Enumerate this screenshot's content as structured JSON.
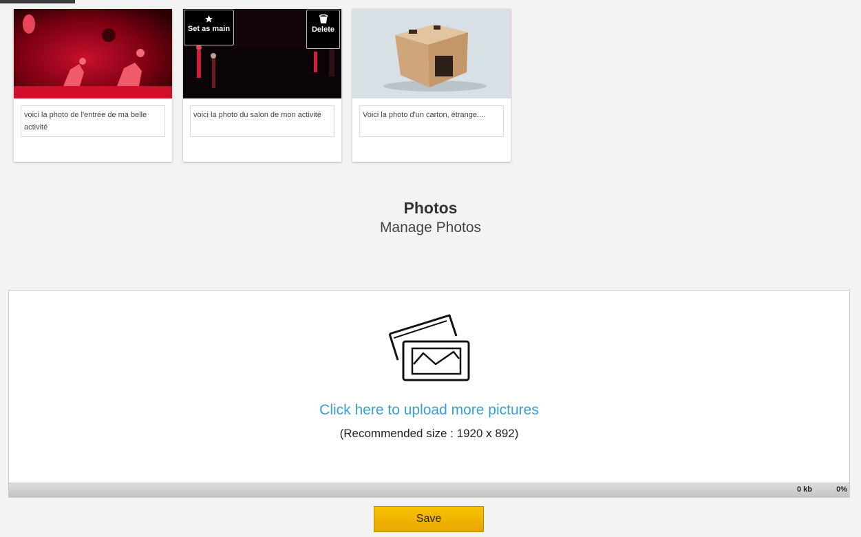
{
  "photos": [
    {
      "caption": "voici la photo de l'entrée de ma belle activité"
    },
    {
      "caption": "voici la photo du salon de mon activité",
      "set_main_label": "Set as main",
      "delete_label": "Delete"
    },
    {
      "caption": "Voici la photo d'un carton, étrange...."
    }
  ],
  "section": {
    "title": "Photos",
    "subtitle": "Manage Photos"
  },
  "upload": {
    "icon": "pictures-icon",
    "link_label": "Click here to upload more pictures",
    "recommended": "(Recommended size : 1920 x 892)",
    "progress_size": "0 kb",
    "progress_percent": "0%",
    "progress_value": 0
  },
  "save_label": "Save",
  "colors": {
    "link": "#3a9fd0",
    "save_button": "#f2b400"
  }
}
